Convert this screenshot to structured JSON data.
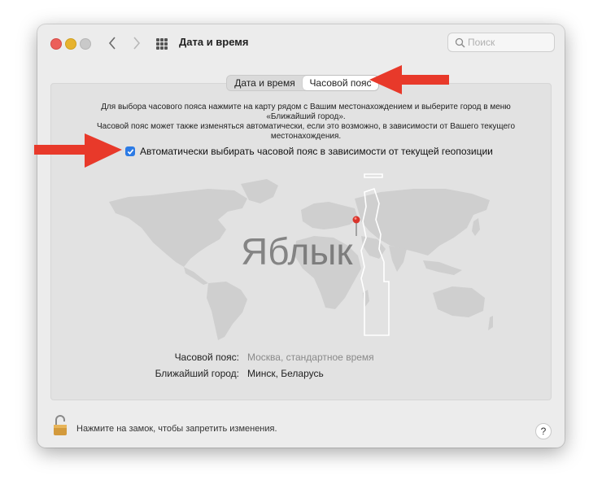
{
  "window": {
    "title": "Дата и время",
    "search_placeholder": "Поиск"
  },
  "tabs": [
    {
      "label": "Дата и время",
      "active": false
    },
    {
      "label": "Часовой пояс",
      "active": true
    }
  ],
  "description": {
    "line1": "Для выбора часового пояса нажмите на карту рядом с Вашим местонахождением и выберите город в меню",
    "line2": "«Ближайший город».",
    "line3": "Часовой пояс может также изменяться автоматически, если это возможно, в зависимости от Вашего текущего",
    "line4": "местонахождения."
  },
  "auto_timezone": {
    "label": "Автоматически выбирать часовой пояс в зависимости от текущей геопозиции",
    "checked": true
  },
  "watermark": "Яблык",
  "timezone": {
    "label": "Часовой пояс:",
    "value": "Москва, стандартное время"
  },
  "closest_city": {
    "label": "Ближайший город:",
    "value": "Минск, Беларусь"
  },
  "footer": {
    "lock_text": "Нажмите на замок, чтобы запретить изменения.",
    "help": "?"
  },
  "colors": {
    "accent": "#2c7be5",
    "arrow": "#e8392a",
    "pin": "#d9342b"
  }
}
